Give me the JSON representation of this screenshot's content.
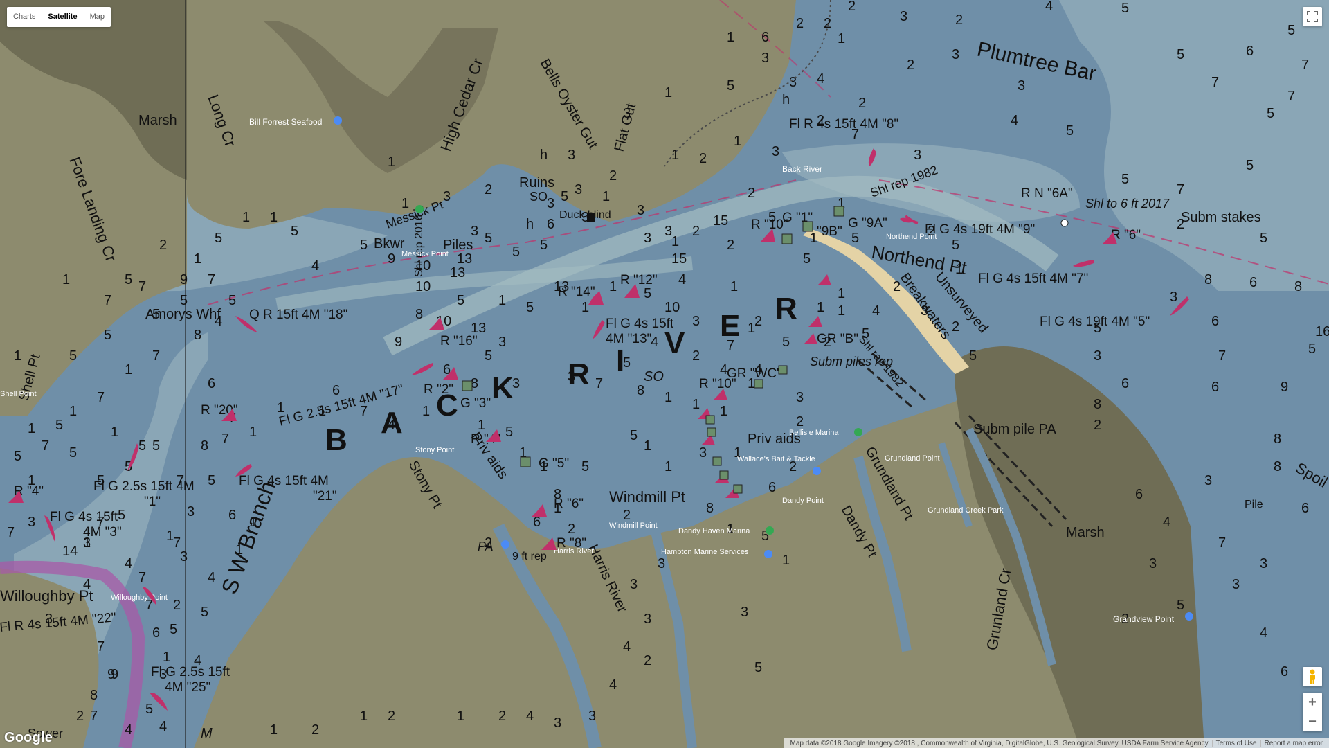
{
  "map_type": {
    "buttons": [
      "Charts",
      "Satellite",
      "Map"
    ],
    "active": "Satellite"
  },
  "colors": {
    "water_deep": "#6f8fa8",
    "water_shallow": "#8aa6b6",
    "land": "#8d8b6e",
    "marsh": "#6f6d55",
    "channel": "#a4bcc2",
    "buoy_red": "#c0306a",
    "buoy_green": "#6b8f6b"
  },
  "labels": {
    "big": [
      "B",
      "A",
      "C",
      "K",
      "R",
      "I",
      "V",
      "E",
      "R"
    ],
    "plumtree": "Plumtree Bar",
    "sw_branch": "S W Branch",
    "marsh_left": "Marsh",
    "marsh_right": "Marsh",
    "long_cr": "Long Cr",
    "fore_landing": "Fore Landing Cr",
    "amorys": "Amorys Whf",
    "shell_pt": "Shell Pt",
    "bill_forrest": "Bill Forrest Seafood",
    "bells_oyster": "Bells Oyster Gut",
    "high_cedar": "High Cedar Cr",
    "flat_gut": "Flat Gut",
    "ruins": "Ruins",
    "so1": "SO",
    "duck_blind": "Duck blind",
    "bkwr": "Bkwr",
    "piles": "Piles",
    "messick": "Messick Pt",
    "messick_point": "Messick Point",
    "northend": "Northend Pt",
    "northend_point": "Northend Point",
    "back_river": "Back River",
    "breakwaters": "Breakwaters",
    "unsurveyed": "Unsurveyed",
    "subm_stakes": "Subm stakes",
    "subm_piles": "Subm piles rep",
    "subm_pile_pa": "Subm pile PA",
    "shl_rep": "Shl rep 1982",
    "shl_rep2": "Shl rep 1982",
    "shl_to": "Shl to 6 ft 2017",
    "shl_2016": "Shl rep 2016",
    "grundland_pt": "Grundland Pt",
    "grundland_point": "Grundland Point",
    "grundland_creek_park": "Grundland Creek Park",
    "grunland_cr": "Grunland Cr",
    "grandview": "Grandview Point",
    "dandy_pt": "Dandy Pt",
    "dandy_point": "Dandy Point",
    "dandy_haven": "Dandy Haven Marina",
    "windmill": "Windmill Pt",
    "windmill_point": "Windmill Point",
    "hampton": "Hampton Marine Services",
    "bellisle": "Bellisle Marina",
    "wallaces": "Wallace's Bait & Tackle",
    "stony_pt": "Stony Pt",
    "stony_point": "Stony Point",
    "harris_river": "Harris River",
    "harris_river2": "Harris River",
    "willoughby": "Willoughby Pt",
    "willoughby_pt": "Willoughby Point",
    "priv_aids": "Priv aids",
    "priv_aids2": "Priv aids",
    "pile": "Pile",
    "spoil": "Spoil",
    "sower": "Sower",
    "m": "M",
    "shell_point": "Shell Point",
    "so_water": "SO",
    "pa": "PA",
    "ft_rep": "9 ft rep"
  },
  "lights": {
    "l8": "Fl R 4s 15ft 4M \"8\"",
    "l9": "Fl G 4s 19ft 4M \"9\"",
    "l7": "Fl G 4s 15ft 4M \"7\"",
    "l5": "Fl G 4s 19ft 4M \"5\"",
    "l18": "Q R 15ft 4M \"18\"",
    "l13_1": "Fl G 4s 15ft",
    "l13_2": "4M \"13\"",
    "l17": "Fl G 2.5s 15ft 4M \"17\"",
    "l21_1": "Fl G 4s 15ft 4M",
    "l21_2": "\"21\"",
    "l1_1": "Fl G 2.5s 15ft 4M",
    "l1_2": "\"1\"",
    "l3_1": "Fl G 4s 15ft",
    "l3_2": "4M \"3\"",
    "l22": "Fl R 4s 15ft 4M \"22\"",
    "l25_1": "Fl G 2.5s 15ft",
    "l25_2": "4M \"25\""
  },
  "marks": {
    "r6a": "R N \"6A\"",
    "r6": "R \"6\"",
    "r14": "R \"14\"",
    "r12": "R \"12\"",
    "r10": "R \"10\"",
    "g1": "G \"1\"",
    "g9b": "\"9B\"",
    "g9a": "G \"9A\"",
    "r16": "R \"16\"",
    "r2": "R \"2\"",
    "g3": "G \"3\"",
    "r4": "R \"4\"",
    "g5": "G \"5\"",
    "r6b": "R \"6\"",
    "r8": "R \"8\"",
    "r20": "R \"20\"",
    "r4b": "R \"4\"",
    "grwc": "GR \"WC\"",
    "rb": "GR \"B\"",
    "r10b": "R \"10\""
  },
  "soundings": [
    [
      1225,
      15,
      "2"
    ],
    [
      1300,
      30,
      "3"
    ],
    [
      1380,
      35,
      "2"
    ],
    [
      1510,
      15,
      "4"
    ],
    [
      1620,
      18,
      "5"
    ],
    [
      1210,
      62,
      "1"
    ],
    [
      1310,
      100,
      "2"
    ],
    [
      1375,
      85,
      "3"
    ],
    [
      1140,
      125,
      "3"
    ],
    [
      1180,
      180,
      "2"
    ],
    [
      1240,
      155,
      "2"
    ],
    [
      1320,
      230,
      "3"
    ],
    [
      1470,
      130,
      "3"
    ],
    [
      1540,
      195,
      "5"
    ],
    [
      1460,
      180,
      "4"
    ],
    [
      1700,
      85,
      "5"
    ],
    [
      1800,
      80,
      "6"
    ],
    [
      1860,
      50,
      "5"
    ],
    [
      1880,
      100,
      "7"
    ],
    [
      1750,
      125,
      "7"
    ],
    [
      1860,
      145,
      "7"
    ],
    [
      1700,
      280,
      "7"
    ],
    [
      1620,
      265,
      "5"
    ],
    [
      1700,
      330,
      "2"
    ],
    [
      1760,
      520,
      "7"
    ],
    [
      1620,
      560,
      "6"
    ],
    [
      1580,
      590,
      "8"
    ],
    [
      1580,
      620,
      "2"
    ],
    [
      1750,
      565,
      "6"
    ],
    [
      1850,
      565,
      "9"
    ],
    [
      1890,
      510,
      "5"
    ],
    [
      1840,
      640,
      "8"
    ],
    [
      1640,
      720,
      "6"
    ],
    [
      1680,
      760,
      "4"
    ],
    [
      1740,
      700,
      "3"
    ],
    [
      1840,
      680,
      "8"
    ],
    [
      1880,
      740,
      "6"
    ],
    [
      1760,
      790,
      "7"
    ],
    [
      1780,
      850,
      "3"
    ],
    [
      1820,
      920,
      "4"
    ],
    [
      1850,
      976,
      "6"
    ],
    [
      1660,
      820,
      "3"
    ],
    [
      1700,
      880,
      "5"
    ],
    [
      1820,
      820,
      "3"
    ],
    [
      1620,
      900,
      "2"
    ],
    [
      1830,
      170,
      "5"
    ],
    [
      1800,
      245,
      "5"
    ],
    [
      1690,
      435,
      "3"
    ],
    [
      1750,
      470,
      "6"
    ],
    [
      1740,
      410,
      "8"
    ],
    [
      1580,
      480,
      "5"
    ],
    [
      1580,
      520,
      "3"
    ],
    [
      1820,
      350,
      "5"
    ],
    [
      1870,
      420,
      "8"
    ],
    [
      1900,
      485,
      "16"
    ],
    [
      1805,
      414,
      "6"
    ],
    [
      1340,
      340,
      "2"
    ],
    [
      1375,
      360,
      "5"
    ],
    [
      1380,
      395,
      "1"
    ],
    [
      1330,
      455,
      "3"
    ],
    [
      1375,
      478,
      "2"
    ],
    [
      1400,
      520,
      "5"
    ],
    [
      1290,
      420,
      "2"
    ],
    [
      1260,
      455,
      "4"
    ],
    [
      1245,
      488,
      "5"
    ],
    [
      1170,
      350,
      "1"
    ],
    [
      1210,
      300,
      "1"
    ],
    [
      1115,
      225,
      "3"
    ],
    [
      1080,
      285,
      "2"
    ],
    [
      1030,
      325,
      "15"
    ],
    [
      970,
      355,
      "1"
    ],
    [
      1055,
      420,
      "1"
    ],
    [
      1000,
      470,
      "3"
    ],
    [
      1090,
      470,
      "2"
    ],
    [
      1130,
      500,
      "5"
    ],
    [
      1040,
      540,
      "4"
    ],
    [
      1000,
      590,
      "1"
    ],
    [
      960,
      580,
      "1"
    ],
    [
      1080,
      560,
      "1"
    ],
    [
      1150,
      580,
      "3"
    ],
    [
      1210,
      455,
      "1"
    ],
    [
      1090,
      540,
      "4"
    ],
    [
      1150,
      615,
      "2"
    ],
    [
      1000,
      520,
      "2"
    ],
    [
      1050,
      505,
      "7"
    ],
    [
      1040,
      600,
      "1"
    ],
    [
      920,
      570,
      "8"
    ],
    [
      910,
      635,
      "5"
    ],
    [
      930,
      650,
      "1"
    ],
    [
      960,
      680,
      "1"
    ],
    [
      1010,
      660,
      "3"
    ],
    [
      1060,
      660,
      "1"
    ],
    [
      1140,
      680,
      "2"
    ],
    [
      1110,
      710,
      "6"
    ],
    [
      1020,
      740,
      "8"
    ],
    [
      1050,
      770,
      "1"
    ],
    [
      1100,
      780,
      "5"
    ],
    [
      1130,
      815,
      "1"
    ],
    [
      1070,
      890,
      "3"
    ],
    [
      1090,
      970,
      "5"
    ],
    [
      900,
      750,
      "2"
    ],
    [
      820,
      770,
      "2"
    ],
    [
      950,
      820,
      "3"
    ],
    [
      910,
      850,
      "3"
    ],
    [
      930,
      900,
      "3"
    ],
    [
      900,
      940,
      "4"
    ],
    [
      930,
      960,
      "2"
    ],
    [
      880,
      995,
      "4"
    ],
    [
      850,
      1040,
      "3"
    ],
    [
      800,
      1050,
      "3"
    ],
    [
      760,
      1040,
      "4"
    ],
    [
      720,
      1040,
      "2"
    ],
    [
      660,
      1040,
      "1"
    ],
    [
      560,
      1040,
      "2"
    ],
    [
      520,
      1040,
      "1"
    ],
    [
      450,
      1060,
      "2"
    ],
    [
      390,
      1060,
      "1"
    ],
    [
      230,
      1055,
      "4"
    ],
    [
      130,
      1040,
      "7"
    ],
    [
      180,
      1060,
      "4"
    ],
    [
      700,
      790,
      "2"
    ],
    [
      770,
      760,
      "6"
    ],
    [
      800,
      740,
      "1"
    ],
    [
      800,
      720,
      "8"
    ],
    [
      840,
      680,
      "5"
    ],
    [
      780,
      680,
      "1"
    ],
    [
      750,
      660,
      "1"
    ],
    [
      730,
      630,
      "5"
    ],
    [
      690,
      620,
      "1"
    ],
    [
      610,
      600,
      "1"
    ],
    [
      560,
      620,
      "4"
    ],
    [
      520,
      600,
      "7"
    ],
    [
      480,
      570,
      "6"
    ],
    [
      460,
      600,
      "1"
    ],
    [
      400,
      595,
      "1"
    ],
    [
      360,
      630,
      "1"
    ],
    [
      300,
      560,
      "6"
    ],
    [
      330,
      610,
      "7"
    ],
    [
      320,
      640,
      "7"
    ],
    [
      300,
      700,
      "5"
    ],
    [
      330,
      750,
      "6"
    ],
    [
      360,
      760,
      "1"
    ],
    [
      340,
      800,
      "1"
    ],
    [
      300,
      840,
      "4"
    ],
    [
      260,
      810,
      "3"
    ],
    [
      250,
      880,
      "2"
    ],
    [
      290,
      890,
      "5"
    ],
    [
      280,
      960,
      "4"
    ],
    [
      230,
      980,
      "3"
    ],
    [
      160,
      980,
      "9"
    ],
    [
      220,
      920,
      "6"
    ],
    [
      250,
      790,
      "7"
    ],
    [
      270,
      745,
      "3"
    ],
    [
      255,
      700,
      "7"
    ],
    [
      220,
      650,
      "5"
    ],
    [
      290,
      650,
      "8"
    ],
    [
      200,
      650,
      "5"
    ],
    [
      160,
      630,
      "1"
    ],
    [
      140,
      580,
      "7"
    ],
    [
      100,
      600,
      "1"
    ],
    [
      80,
      620,
      "5"
    ],
    [
      40,
      625,
      "1"
    ],
    [
      60,
      650,
      "7"
    ],
    [
      100,
      660,
      "5"
    ],
    [
      140,
      700,
      "5"
    ],
    [
      180,
      680,
      "5"
    ],
    [
      170,
      750,
      "5"
    ],
    [
      140,
      760,
      "7"
    ],
    [
      120,
      790,
      "1"
    ],
    [
      240,
      780,
      "1"
    ],
    [
      120,
      850,
      "4"
    ],
    [
      40,
      760,
      "3"
    ],
    [
      40,
      700,
      "1"
    ],
    [
      20,
      665,
      "5"
    ],
    [
      10,
      775,
      "7"
    ],
    [
      90,
      802,
      "14"
    ],
    [
      120,
      790,
      "3"
    ],
    [
      65,
      900,
      "3"
    ],
    [
      110,
      1040,
      "2"
    ],
    [
      140,
      940,
      "7"
    ],
    [
      180,
      820,
      "4"
    ],
    [
      200,
      840,
      "7"
    ],
    [
      210,
      880,
      "7"
    ],
    [
      245,
      915,
      "5"
    ],
    [
      235,
      955,
      "1"
    ],
    [
      155,
      980,
      "9"
    ],
    [
      210,
      1030,
      "5"
    ],
    [
      130,
      1010,
      "8"
    ],
    [
      20,
      520,
      "1"
    ],
    [
      100,
      520,
      "5"
    ],
    [
      180,
      540,
      "1"
    ],
    [
      220,
      520,
      "7"
    ],
    [
      220,
      460,
      "5"
    ],
    [
      260,
      440,
      "5"
    ],
    [
      280,
      490,
      "8"
    ],
    [
      300,
      410,
      "7"
    ],
    [
      330,
      440,
      "5"
    ],
    [
      310,
      470,
      "4"
    ],
    [
      260,
      410,
      "9"
    ],
    [
      180,
      410,
      "5"
    ],
    [
      90,
      410,
      "1"
    ],
    [
      150,
      440,
      "7"
    ],
    [
      150,
      490,
      "5"
    ],
    [
      230,
      360,
      "2"
    ],
    [
      200,
      420,
      "7"
    ],
    [
      280,
      380,
      "1"
    ],
    [
      310,
      350,
      "5"
    ],
    [
      350,
      320,
      "1"
    ],
    [
      390,
      320,
      "1"
    ],
    [
      420,
      340,
      "5"
    ],
    [
      520,
      360,
      "5"
    ],
    [
      450,
      390,
      "4"
    ],
    [
      560,
      380,
      "9"
    ],
    [
      600,
      390,
      "10"
    ],
    [
      650,
      400,
      "13"
    ],
    [
      600,
      420,
      "10"
    ],
    [
      600,
      460,
      "8"
    ],
    [
      570,
      500,
      "9"
    ],
    [
      630,
      470,
      "10"
    ],
    [
      680,
      480,
      "13"
    ],
    [
      660,
      440,
      "5"
    ],
    [
      700,
      350,
      "5"
    ],
    [
      740,
      370,
      "5"
    ],
    [
      780,
      360,
      "5"
    ],
    [
      840,
      320,
      "3"
    ],
    [
      830,
      280,
      "3"
    ],
    [
      790,
      330,
      "6"
    ],
    [
      760,
      330,
      "h"
    ],
    [
      870,
      290,
      "1"
    ],
    [
      930,
      350,
      "3"
    ],
    [
      960,
      340,
      "3"
    ],
    [
      1000,
      340,
      "2"
    ],
    [
      970,
      380,
      "15"
    ],
    [
      980,
      410,
      "4"
    ],
    [
      960,
      450,
      "10"
    ],
    [
      930,
      430,
      "5"
    ],
    [
      880,
      420,
      "1"
    ],
    [
      840,
      450,
      "1"
    ],
    [
      800,
      420,
      "13"
    ],
    [
      760,
      450,
      "5"
    ],
    [
      720,
      440,
      "1"
    ],
    [
      720,
      500,
      "3"
    ],
    [
      700,
      520,
      "5"
    ],
    [
      680,
      560,
      "8"
    ],
    [
      640,
      540,
      "6"
    ],
    [
      740,
      560,
      "3"
    ],
    [
      820,
      550,
      "3"
    ],
    [
      860,
      560,
      "7"
    ],
    [
      900,
      530,
      "5"
    ],
    [
      940,
      500,
      "4"
    ],
    [
      1060,
      210,
      "1"
    ],
    [
      1010,
      235,
      "2"
    ],
    [
      1050,
      360,
      "2"
    ],
    [
      1110,
      320,
      "5"
    ],
    [
      1080,
      480,
      "1"
    ],
    [
      1160,
      380,
      "5"
    ],
    [
      1180,
      450,
      "1"
    ],
    [
      1230,
      350,
      "5"
    ],
    [
      1210,
      430,
      "1"
    ],
    [
      1190,
      500,
      "2"
    ],
    [
      970,
      230,
      "1"
    ],
    [
      880,
      260,
      "2"
    ],
    [
      920,
      310,
      "3"
    ],
    [
      790,
      300,
      "3"
    ],
    [
      810,
      290,
      "5"
    ],
    [
      700,
      280,
      "2"
    ],
    [
      680,
      340,
      "3"
    ],
    [
      660,
      380,
      "13"
    ],
    [
      580,
      300,
      "1"
    ],
    [
      560,
      240,
      "1"
    ],
    [
      640,
      290,
      "3"
    ],
    [
      780,
      230,
      "h"
    ],
    [
      820,
      230,
      "3"
    ],
    [
      900,
      170,
      "3"
    ],
    [
      960,
      140,
      "1"
    ],
    [
      1050,
      130,
      "5"
    ],
    [
      1100,
      90,
      "3"
    ],
    [
      1180,
      120,
      "4"
    ],
    [
      1130,
      150,
      "h"
    ],
    [
      1230,
      200,
      "7"
    ],
    [
      1050,
      60,
      "1"
    ],
    [
      1100,
      60,
      "6"
    ],
    [
      1150,
      40,
      "2"
    ],
    [
      1190,
      40,
      "2"
    ]
  ],
  "attribution": {
    "map_data": "Map data ©2018 Google Imagery ©2018 , Commonwealth of Virginia, DigitalGlobe, U.S. Geological Survey, USDA Farm Service Agency",
    "terms": "Terms of Use",
    "report": "Report a map error"
  },
  "google": "Google"
}
